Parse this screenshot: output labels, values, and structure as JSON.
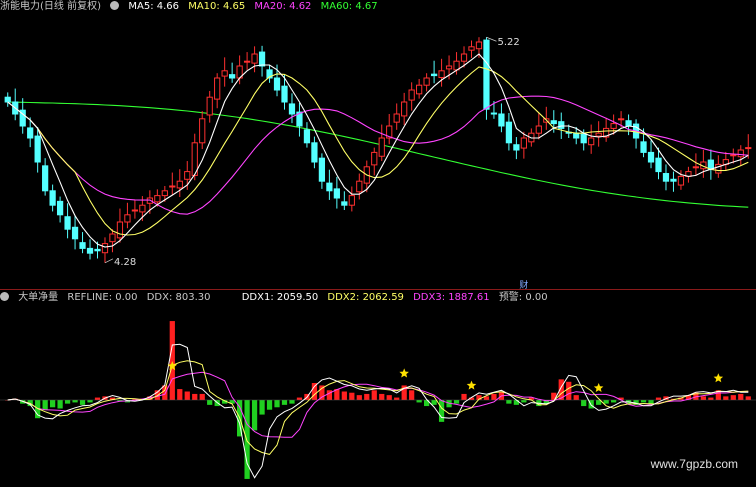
{
  "header_top": {
    "title": "浙能电力(日线 前复权)",
    "ma5": "MA5: 4.66",
    "ma10": "MA10: 4.65",
    "ma20": "MA20: 4.62",
    "ma60": "MA60: 4.67"
  },
  "header_bottom": {
    "name": "大单净量",
    "refline": "REFLINE: 0.00",
    "ddx": "DDX: 803.30",
    "ddx1": "DDX1: 2059.50",
    "ddx2": "DDX2: 2062.59",
    "ddx3": "DDX3: 1887.61",
    "warn": "预警: 0.00"
  },
  "watermark": "www.7gpzb.com",
  "colors": {
    "up": "#ff3030",
    "down": "#54ffff",
    "ma5": "#ffffff",
    "ma10": "#ffff66",
    "ma20": "#ff44ff",
    "ma60": "#33ff33",
    "bar_up": "#ff2020",
    "bar_down": "#20d020",
    "ddx1": "#ffffff",
    "ddx2": "#ffff66",
    "ddx3": "#ff44ff"
  },
  "chart_data": [
    {
      "type": "candlestick",
      "annotations": [
        {
          "label": "5.22",
          "point": "high"
        },
        {
          "label": "4.28",
          "point": "low"
        }
      ],
      "markers": [
        {
          "label": "财"
        }
      ],
      "series": [
        {
          "name": "MA5",
          "value": 4.66
        },
        {
          "name": "MA10",
          "value": 4.65
        },
        {
          "name": "MA20",
          "value": 4.62
        },
        {
          "name": "MA60",
          "value": 4.67
        }
      ],
      "close": [
        4.95,
        4.9,
        4.85,
        4.8,
        4.7,
        4.58,
        4.52,
        4.48,
        4.42,
        4.38,
        4.34,
        4.32,
        4.33,
        4.36,
        4.4,
        4.45,
        4.48,
        4.5,
        4.52,
        4.55,
        4.56,
        4.58,
        4.6,
        4.62,
        4.66,
        4.78,
        4.88,
        4.97,
        5.05,
        5.08,
        5.05,
        5.1,
        5.12,
        5.15,
        5.1,
        5.05,
        5.0,
        4.95,
        4.9,
        4.85,
        4.78,
        4.7,
        4.62,
        4.58,
        4.55,
        4.52,
        4.56,
        4.62,
        4.68,
        4.74,
        4.8,
        4.85,
        4.9,
        4.95,
        5.0,
        5.02,
        5.05,
        5.06,
        5.08,
        5.1,
        5.12,
        5.15,
        5.18,
        5.2,
        4.92,
        4.9,
        4.85,
        4.78,
        4.75,
        4.8,
        4.82,
        4.85,
        4.88,
        4.86,
        4.84,
        4.82,
        4.8,
        4.78,
        4.8,
        4.82,
        4.84,
        4.86,
        4.88,
        4.85,
        4.8,
        4.74,
        4.7,
        4.66,
        4.62,
        4.62,
        4.64,
        4.66,
        4.68,
        4.7,
        4.67,
        4.69,
        4.71,
        4.73,
        4.75,
        4.76
      ]
    },
    {
      "type": "bar",
      "name": "大单净量",
      "values": [
        0,
        0.1,
        -0.3,
        -0.5,
        -1.5,
        -0.8,
        -0.6,
        -0.7,
        -0.3,
        -0.2,
        -0.4,
        -0.2,
        0.2,
        0.3,
        0.2,
        -0.1,
        -0.2,
        0.1,
        0.1,
        0.3,
        0.8,
        1.2,
        6.5,
        0.9,
        0.7,
        0.5,
        0.5,
        -0.4,
        -0.5,
        -0.3,
        -0.3,
        -3.0,
        -6.5,
        -2.5,
        -1.2,
        -0.8,
        -0.6,
        -0.4,
        -0.3,
        0.2,
        0.5,
        1.4,
        1.2,
        0.8,
        0.9,
        0.7,
        0.6,
        0.4,
        0.5,
        0.8,
        0.5,
        0.4,
        0.2,
        1.2,
        0.8,
        -0.2,
        -0.5,
        -0.4,
        -1.8,
        -0.6,
        -0.3,
        0.5,
        0.2,
        0.4,
        0.3,
        0.5,
        0.7,
        -0.3,
        -0.4,
        -0.2,
        0.2,
        -0.5,
        -0.3,
        0.6,
        1.7,
        1.5,
        0.4,
        -0.5,
        -0.7,
        -0.4,
        -0.3,
        -0.2,
        0.2,
        -0.3,
        -0.4,
        -0.2,
        -0.3,
        0.2,
        0.3,
        0.1,
        0.2,
        0.4,
        0.6,
        0.3,
        0.2,
        0.8,
        0.3,
        0.4,
        0.5,
        0.3
      ],
      "stars": [
        22,
        53,
        62,
        79,
        95
      ]
    }
  ]
}
